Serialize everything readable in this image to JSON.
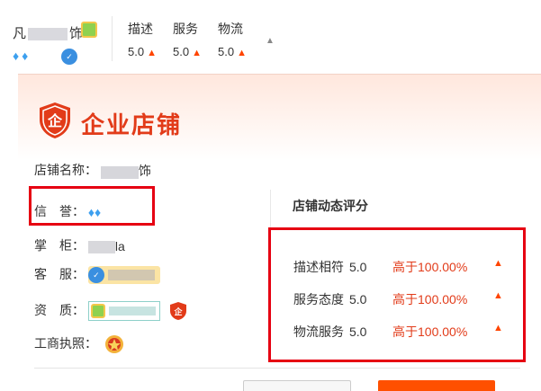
{
  "top": {
    "shop_name_parts": [
      "凡",
      "饰"
    ],
    "diamonds": "♦♦",
    "ww_icon": "wangwang-icon",
    "scores": [
      {
        "label": "描述",
        "value": "5.0"
      },
      {
        "label": "服务",
        "value": "5.0"
      },
      {
        "label": "物流",
        "value": "5.0"
      }
    ],
    "arrow": "▲",
    "caret": "▲"
  },
  "card": {
    "title": "企业店铺",
    "shield_glyph": "企",
    "fields": {
      "name_label": "店铺名称：",
      "name_value_parts": [
        "凡",
        "饰"
      ],
      "reputation_label": "信　誉：",
      "reputation_value": "♦♦",
      "keeper_label": "掌　柜：",
      "keeper_value": "la",
      "service_label": "客　服：",
      "cert_label": "资　质：",
      "license_label": "工商执照："
    },
    "dsr": {
      "title": "店铺动态评分",
      "rows": [
        {
          "label": "描述相符",
          "score": "5.0",
          "compare": "高于100.00%"
        },
        {
          "label": "服务态度",
          "score": "5.0",
          "compare": "高于100.00%"
        },
        {
          "label": "物流服务",
          "score": "5.0",
          "compare": "高于100.00%"
        }
      ],
      "arrow": "▲"
    }
  },
  "colors": {
    "accent": "#e23b19",
    "highlight_box": "#e60012",
    "arrow": "#ff4400",
    "diamond": "#3da0ef"
  }
}
